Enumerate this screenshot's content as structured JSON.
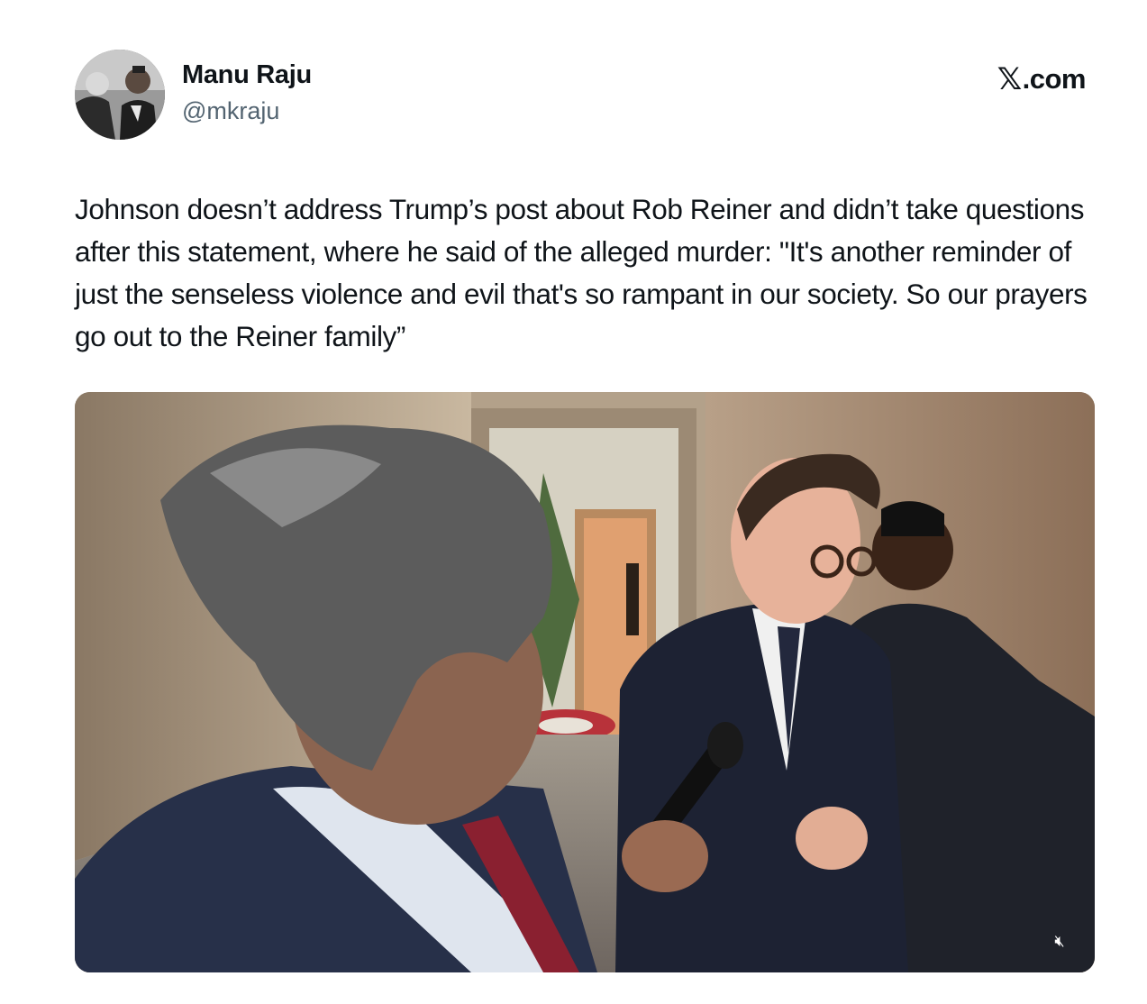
{
  "author": {
    "name": "Manu Raju",
    "handle": "@mkraju"
  },
  "source": {
    "mark": "𝕏",
    "domain": ".com"
  },
  "tweet": {
    "text": "Johnson doesn’t address Trump’s post about Rob Reiner and didn’t take questions after this statement, where he said of the alleged murder: \"It's another reminder of just the senseless violence and evil that's so rampant in our society. So our prayers go out to the Reiner family”"
  },
  "media": {
    "type": "video",
    "muted_icon": "speaker-muted-icon"
  },
  "colors": {
    "text": "#0f1419",
    "secondary": "#536471",
    "background": "#ffffff"
  }
}
